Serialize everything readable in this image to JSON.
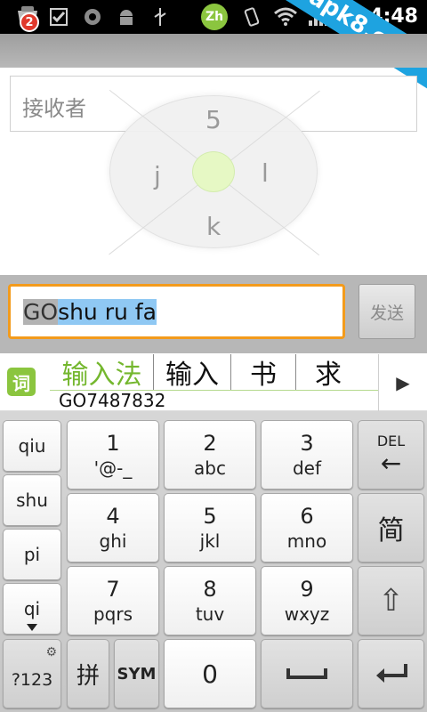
{
  "status_bar": {
    "notification_count": "2",
    "ime_badge": "Zh",
    "time": "4:48",
    "watermark": "apk8.com"
  },
  "recipient": {
    "placeholder": "接收者"
  },
  "gesture_pad": {
    "up": "5",
    "left": "j",
    "right": "l",
    "down": "k"
  },
  "composer": {
    "text_part1": "GO",
    "text_part2": "shu ru fa",
    "send_label": "发送"
  },
  "candidates": {
    "icon_label": "词",
    "items": [
      "输入法",
      "输入",
      "书",
      "求"
    ],
    "pinyin": "GO7487832",
    "more_arrow": "▶"
  },
  "keyboard": {
    "side_keys": [
      "qiu",
      "shu",
      "pi",
      "qi"
    ],
    "keys": [
      {
        "top": "1",
        "sub": "'@-_"
      },
      {
        "top": "2",
        "sub": "abc"
      },
      {
        "top": "3",
        "sub": "def"
      },
      {
        "top": "4",
        "sub": "ghi"
      },
      {
        "top": "5",
        "sub": "jkl"
      },
      {
        "top": "6",
        "sub": "mno"
      },
      {
        "top": "7",
        "sub": "pqrs"
      },
      {
        "top": "8",
        "sub": "tuv"
      },
      {
        "top": "9",
        "sub": "wxyz"
      }
    ],
    "del_label": "DEL",
    "del_arrow": "←",
    "simplified_label": "简",
    "shift_glyph": "⇧",
    "sym_123_label": "?123",
    "pinyin_mode_label": "拼",
    "sym_label": "SYM",
    "zero_label": "0",
    "space_glyph": "␣",
    "enter_glyph": "↵"
  }
}
